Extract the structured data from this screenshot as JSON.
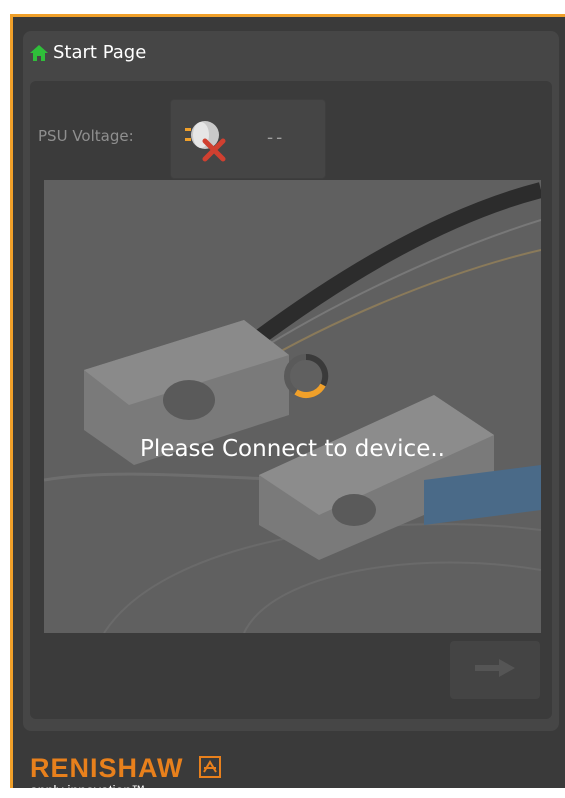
{
  "window": {
    "title": "Start Page"
  },
  "psu": {
    "label": "PSU Voltage:",
    "value": "--",
    "status_icon": "plug-disconnected-icon"
  },
  "main": {
    "message": "Please Connect to device.."
  },
  "footer": {
    "brand": "RENISHAW",
    "tagline": "apply innovation™"
  },
  "colors": {
    "accent": "#f0a02a",
    "brand": "#e8801c",
    "home_icon": "#2fbf3a",
    "spinner": "#f0a02a"
  }
}
